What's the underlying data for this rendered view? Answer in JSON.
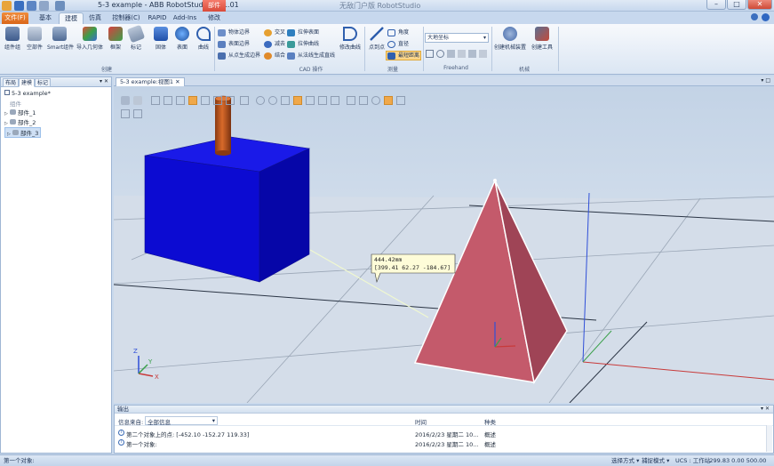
{
  "window": {
    "title": "5-3 example - ABB RobotStudio 6.01.01",
    "badge": "部件",
    "doc_title": "无敌门户版 RobotStudio",
    "min_glyph": "–",
    "max_glyph": "□",
    "close_glyph": "✕"
  },
  "tabs": {
    "file": "文件(F)",
    "items": [
      "基本",
      "建模",
      "仿真",
      "控制器(C)",
      "RAPID",
      "Add-Ins",
      "修改"
    ],
    "active_index": 1
  },
  "ribbon": {
    "create": {
      "label": "创建",
      "buttons": [
        "组件组",
        "空部件",
        "Smart组件",
        "导入几何体",
        "框架",
        "标记",
        "固体",
        "表面",
        "曲线"
      ]
    },
    "cad": {
      "label": "CAD 操作",
      "small": [
        "物体边界",
        "表面边界",
        "从点生成边界",
        "交叉",
        "减去",
        "结合",
        "拉伸表面",
        "拉伸曲线",
        "从法线生成直线"
      ],
      "big": "修改曲线"
    },
    "measure": {
      "label": "测量",
      "big": "点到点",
      "small": [
        "角度",
        "直径",
        "最短距离"
      ]
    },
    "freehand": {
      "label": "Freehand",
      "dropdown": "大地坐标"
    },
    "mechanism": {
      "label": "机械",
      "buttons": [
        "创建机械装置",
        "创建工具"
      ]
    },
    "accent_color": "#f4b24a"
  },
  "left_panel": {
    "tabs": [
      "布局",
      "建模",
      "标记"
    ],
    "active_tab": 1,
    "pin": "▾ ✕",
    "tree": {
      "root": "5-3 example*",
      "group": "组件",
      "parts": [
        "部件_1",
        "部件_2",
        "部件_3"
      ],
      "selected_index": 2
    }
  },
  "viewport": {
    "tab_label": "5-3 example:视图1",
    "tab_close": "✕",
    "measure_distance": "444.42mm",
    "measure_vector": "[399.41 62.27 -184.67]",
    "axis_x": "X",
    "axis_y": "Y",
    "axis_z": "Z",
    "colors": {
      "floor": "#d2dbe7",
      "box_front": "#0c0bd2",
      "box_top": "#1a1ae8",
      "box_side": "#0606a8",
      "cylinder": "#c85a1e",
      "pyramid_front": "#c45a6b",
      "pyramid_side": "#9f4456"
    }
  },
  "output": {
    "title": "输出",
    "filter_label": "信息来自:",
    "filter_value": "全部信息",
    "col_time": "时间",
    "col_kind": "种类",
    "rows": [
      {
        "msg": "第二个对象上的点: [-452.10 -152.27 119.33]",
        "time": "2016/2/23 星期二 10...",
        "kind": "概述"
      },
      {
        "msg": "第一个对象:",
        "time": "2016/2/23 星期二 10...",
        "kind": "概述"
      }
    ]
  },
  "statusbar": {
    "left": "第一个对象:",
    "select_mode": "选择方式 ▾",
    "snap_mode": "捕捉模式 ▾",
    "ucs": "UCS : 工作站",
    "coords": "-299.83   0.00   500.00"
  }
}
